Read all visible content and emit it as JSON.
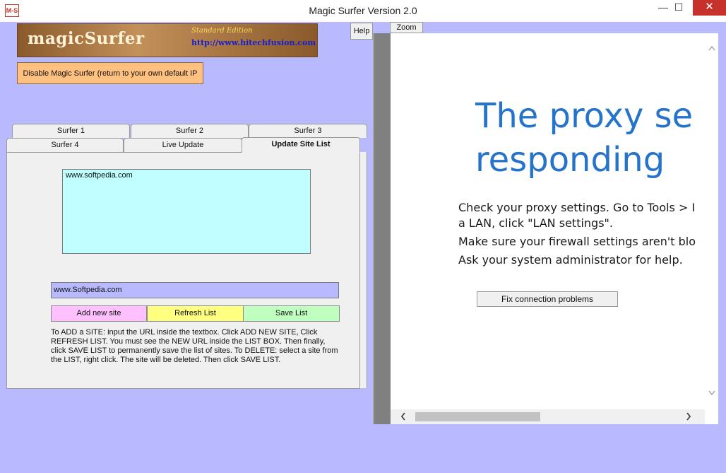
{
  "window": {
    "title": "Magic Surfer Version 2.0",
    "app_icon_label": "M-S",
    "min_glyph": "—",
    "max_glyph": "☐",
    "close_glyph": "✕"
  },
  "logo": {
    "name": "magicSurfer",
    "edition": "Standard Edition",
    "url": "http://www.hitechfusion.com"
  },
  "toolbar": {
    "disable_label": "Disable Magic Surfer (return to your own default IP",
    "help_label": "Help",
    "zoom_label": "Zoom"
  },
  "tabs": {
    "surfer1": "Surfer 1",
    "surfer2": "Surfer 2",
    "surfer3": "Surfer 3",
    "surfer4": "Surfer 4",
    "live_update": "Live Update",
    "update_site_list": "Update Site List",
    "active": "Update Site List"
  },
  "site_list": {
    "items": [
      "www.softpedia.com"
    ],
    "input_value": "www.Softpedia.com"
  },
  "buttons": {
    "add": "Add new site",
    "refresh": "Refresh List",
    "save": "Save List"
  },
  "instructions": "To ADD a SITE: input the URL inside the textbox. Click ADD NEW SITE, Click REFRESH LIST. You must see the NEW URL inside the LIST BOX. Then finally, click SAVE LIST to permanently save the list of sites. To DELETE: select a site from the LIST, right click. The site will be deleted. Then click SAVE LIST.",
  "browser": {
    "title_line1": "The proxy se",
    "title_line2": "responding",
    "msg1_line1": "Check your proxy settings. Go to Tools > I",
    "msg1_line2": "a LAN, click \"LAN settings\".",
    "msg2": "Make sure your firewall settings aren't blo",
    "msg3": "Ask your system administrator for help.",
    "fix_button": "Fix connection problems"
  },
  "colors": {
    "client_bg": "#b9b9ff",
    "error_title": "#2673cc",
    "list_bg": "#c0ffff",
    "add_btn": "#ffc0ff",
    "refresh_btn": "#ffff80",
    "save_btn": "#c0ffc0",
    "disable_btn": "#ffc080",
    "close_btn": "#c7312b"
  },
  "icons": {
    "app": "app-icon",
    "scroll_up": "chevron-up-icon",
    "scroll_down": "chevron-down-icon",
    "scroll_left": "chevron-left-icon",
    "scroll_right": "chevron-right-icon"
  }
}
